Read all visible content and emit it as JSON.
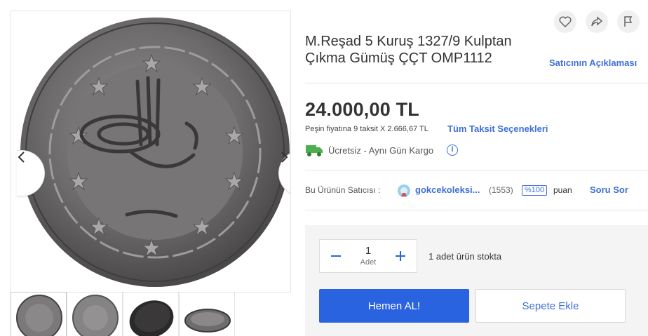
{
  "product": {
    "title": "M.Reşad 5 Kuruş 1327/9 Kulptan Çıkma Gümüş ÇÇT OMP1112",
    "seller_note_link": "Satıcının Açıklaması"
  },
  "actions": {
    "favorite_icon": "heart-icon",
    "share_icon": "share-icon",
    "report_icon": "flag-icon"
  },
  "gallery": {
    "prev_icon": "chevron-left-icon",
    "next_icon": "chevron-right-icon",
    "thumbnails": [
      "coin-obverse",
      "coin-reverse",
      "coin-edge-dark",
      "coin-edge-side"
    ]
  },
  "price": {
    "amount": "24.000,00 TL",
    "installment_text": "Peşin fiyatına 9 taksit X 2.666,67 TL",
    "installment_link": "Tüm Taksit Seçenekleri"
  },
  "shipping": {
    "text": "Ücretsiz - Aynı Gün Kargo",
    "info_glyph": "i"
  },
  "seller": {
    "label": "Bu Ürünün Satıcısı :",
    "name": "gokcekoleksi...",
    "count": "(1553)",
    "badge": "%100",
    "score_label": "puan",
    "ask_link": "Soru Sor"
  },
  "purchase": {
    "quantity": "1",
    "unit": "Adet",
    "minus": "−",
    "plus": "+",
    "stock_text": "1 adet ürün stokta",
    "buy_button": "Hemen AL!",
    "cart_button": "Sepete Ekle"
  },
  "colors": {
    "accent": "#2a63e0",
    "link": "#3f6fd8",
    "cargo_green": "#4caf50"
  }
}
